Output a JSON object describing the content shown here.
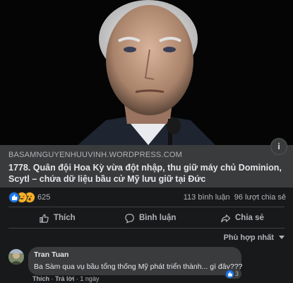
{
  "post": {
    "photo_alt": "Portrait photo",
    "link_domain": "BASAMNGUYENHUUVINH.WORDPRESS.COM",
    "link_title": "1778. Quân đội Hoa Kỳ vừa đột nhập, thu giữ máy chủ Dominion, Scytl – chứa dữ liệu bầu cử Mỹ lưu giữ tại Đức",
    "info_label": "i"
  },
  "stats": {
    "reaction_count": "625",
    "comments": "113 bình luận",
    "shares": "96 lượt chia sẻ",
    "reaction_icons": [
      "like-icon",
      "haha-icon",
      "wow-icon"
    ],
    "colors": {
      "like": "#1877f2",
      "haha": "#f7b125",
      "wow": "#f7b125"
    }
  },
  "actions": {
    "like": "Thích",
    "comment": "Bình luận",
    "share": "Chia sẻ"
  },
  "sort": {
    "label": "Phù hợp nhất"
  },
  "comment": {
    "author": "Tran Tuan",
    "text": "Ba Sàm qua vụ bầu tổng thống Mỹ phát triển thành... gì đây???",
    "like_count": "3",
    "like_action": "Thích",
    "reply_action": "Trả lời",
    "time": "1 ngày"
  }
}
